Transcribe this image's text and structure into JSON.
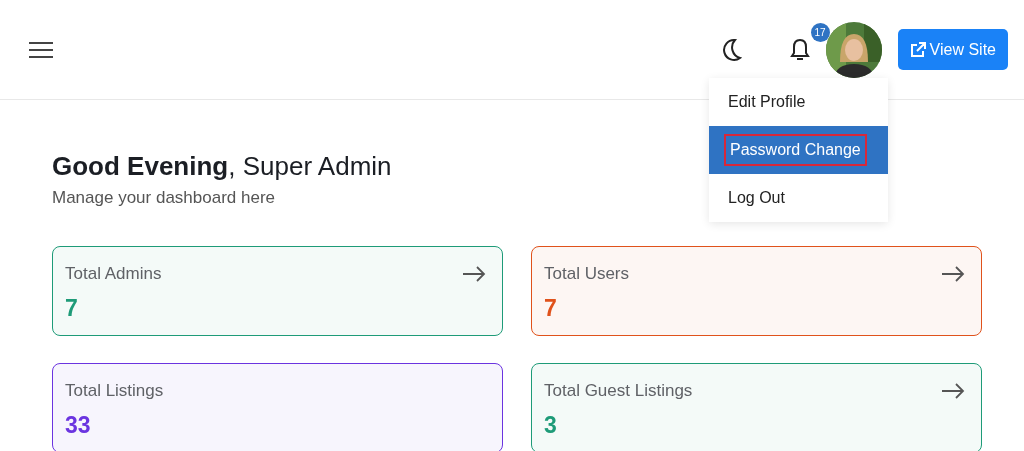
{
  "header": {
    "notifications": {
      "count": "17"
    },
    "view_site_button": "View Site"
  },
  "profile_menu": {
    "open": true,
    "items": [
      {
        "label": "Edit Profile",
        "selected": false,
        "outlined": false
      },
      {
        "label": "Password Change",
        "selected": true,
        "outlined": true
      },
      {
        "label": "Log Out",
        "selected": false,
        "outlined": false
      }
    ]
  },
  "greeting": {
    "title": "**Good Evening**, Super Admin",
    "subtitle": "Manage your dashboard here"
  },
  "stats": [
    {
      "label": "Total Admins",
      "value": "7",
      "color": "#1e9b78",
      "arrow": true
    },
    {
      "label": "Total Users",
      "value": "7",
      "color": "#e0521b",
      "arrow": true
    },
    {
      "label": "Total Listings",
      "value": "33",
      "color": "#6b34e0",
      "arrow": false
    },
    {
      "label": "Total Guest Listings",
      "value": "3",
      "color": "#1e9b78",
      "arrow": true
    }
  ]
}
